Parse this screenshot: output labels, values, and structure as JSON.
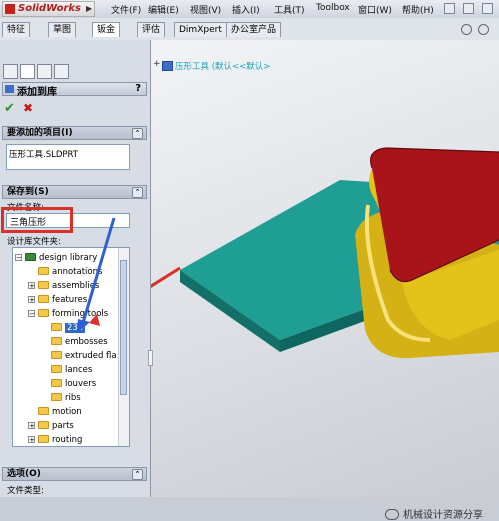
{
  "app": {
    "title": "SolidWorks"
  },
  "menu": {
    "file": "文件(F)",
    "edit": "编辑(E)",
    "view": "视图(V)",
    "insert": "插入(I)",
    "tools": "工具(T)",
    "toolbox": "Toolbox",
    "window": "窗口(W)",
    "help": "帮助(H)"
  },
  "tabs": [
    "特征",
    "草图",
    "钣金",
    "评估",
    "DimXpert",
    "办公室产品"
  ],
  "tabs_active": "钣金",
  "feature_tree": {
    "breadcrumb": "压形工具  (默认<<默认>"
  },
  "property_manager": {
    "title": "添加到库",
    "help_symbol": "?",
    "ok_symbol": "✔",
    "cancel_symbol": "✖",
    "items_section": {
      "header": "要添加的项目(I)",
      "item": "压形工具.SLDPRT"
    },
    "save_section": {
      "header": "保存到(S)",
      "filename_label": "文件名称:",
      "filename_value": "三角压形",
      "folder_label": "设计库文件夹:",
      "tree": [
        {
          "label": "design library",
          "level": 0,
          "expander": "−"
        },
        {
          "label": "annotations",
          "level": 1,
          "expander": ""
        },
        {
          "label": "assemblies",
          "level": 1,
          "expander": "+"
        },
        {
          "label": "features",
          "level": 1,
          "expander": "+"
        },
        {
          "label": "forming tools",
          "level": 1,
          "expander": "−"
        },
        {
          "label": "234",
          "level": 2,
          "expander": "",
          "selected": true
        },
        {
          "label": "embosses",
          "level": 2,
          "expander": ""
        },
        {
          "label": "extruded fla",
          "level": 2,
          "expander": ""
        },
        {
          "label": "lances",
          "level": 2,
          "expander": ""
        },
        {
          "label": "louvers",
          "level": 2,
          "expander": ""
        },
        {
          "label": "ribs",
          "level": 2,
          "expander": ""
        },
        {
          "label": "motion",
          "level": 1,
          "expander": ""
        },
        {
          "label": "parts",
          "level": 1,
          "expander": "+"
        },
        {
          "label": "routing",
          "level": 1,
          "expander": "+"
        }
      ]
    },
    "options_section": {
      "header": "选项(O)",
      "filetype_label": "文件类型:"
    },
    "collapse_symbol": "⌃"
  },
  "watermark": "机械设计资源分享",
  "colors": {
    "plate": "#1f9e94",
    "plate_edge": "#127068",
    "boss_side": "#e3c21a",
    "boss_top": "#a8141a",
    "annotation_red": "#d9302a",
    "arrow_blue": "#2d5fd6"
  }
}
